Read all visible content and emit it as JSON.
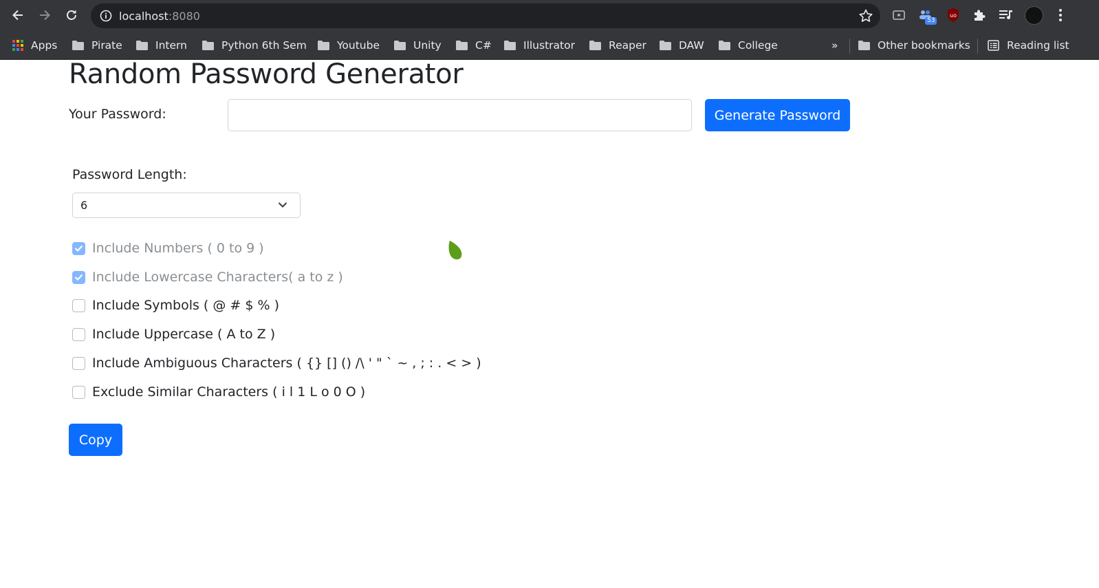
{
  "browser": {
    "url_host": "localhost",
    "url_port": ":8080",
    "extension_badge": "53",
    "bookmarks": [
      "Apps",
      "Pirate",
      "Intern",
      "Python 6th Sem",
      "Youtube",
      "Unity",
      "C#",
      "Illustrator",
      "Reaper",
      "DAW",
      "College"
    ],
    "more_bookmarks": "»",
    "other_bookmarks": "Other bookmarks",
    "reading_list": "Reading list"
  },
  "page": {
    "title": "Random Password Generator",
    "password_label": "Your Password:",
    "password_value": "",
    "generate_button": "Generate Password",
    "length_label": "Password Length:",
    "length_value": "6",
    "options": [
      {
        "label": "Include Numbers ( 0 to 9 )",
        "checked": true,
        "disabled": true
      },
      {
        "label": "Include Lowercase Characters( a to z )",
        "checked": true,
        "disabled": true
      },
      {
        "label": "Include Symbols ( @ # $ % )",
        "checked": false,
        "disabled": false
      },
      {
        "label": "Include Uppercase ( A to Z )",
        "checked": false,
        "disabled": false
      },
      {
        "label": "Include Ambiguous Characters ( {} [] () /\\ ' \" ` ~ , ; : . < > )",
        "checked": false,
        "disabled": false
      },
      {
        "label": "Exclude Similar Characters ( i l 1 L o 0 O )",
        "checked": false,
        "disabled": false
      }
    ],
    "copy_button": "Copy"
  },
  "colors": {
    "primary": "#0d6efd",
    "checked_disabled": "#86b7fe",
    "chrome_bg": "#35363a",
    "cursor_leaf": "#5a9e1a"
  }
}
